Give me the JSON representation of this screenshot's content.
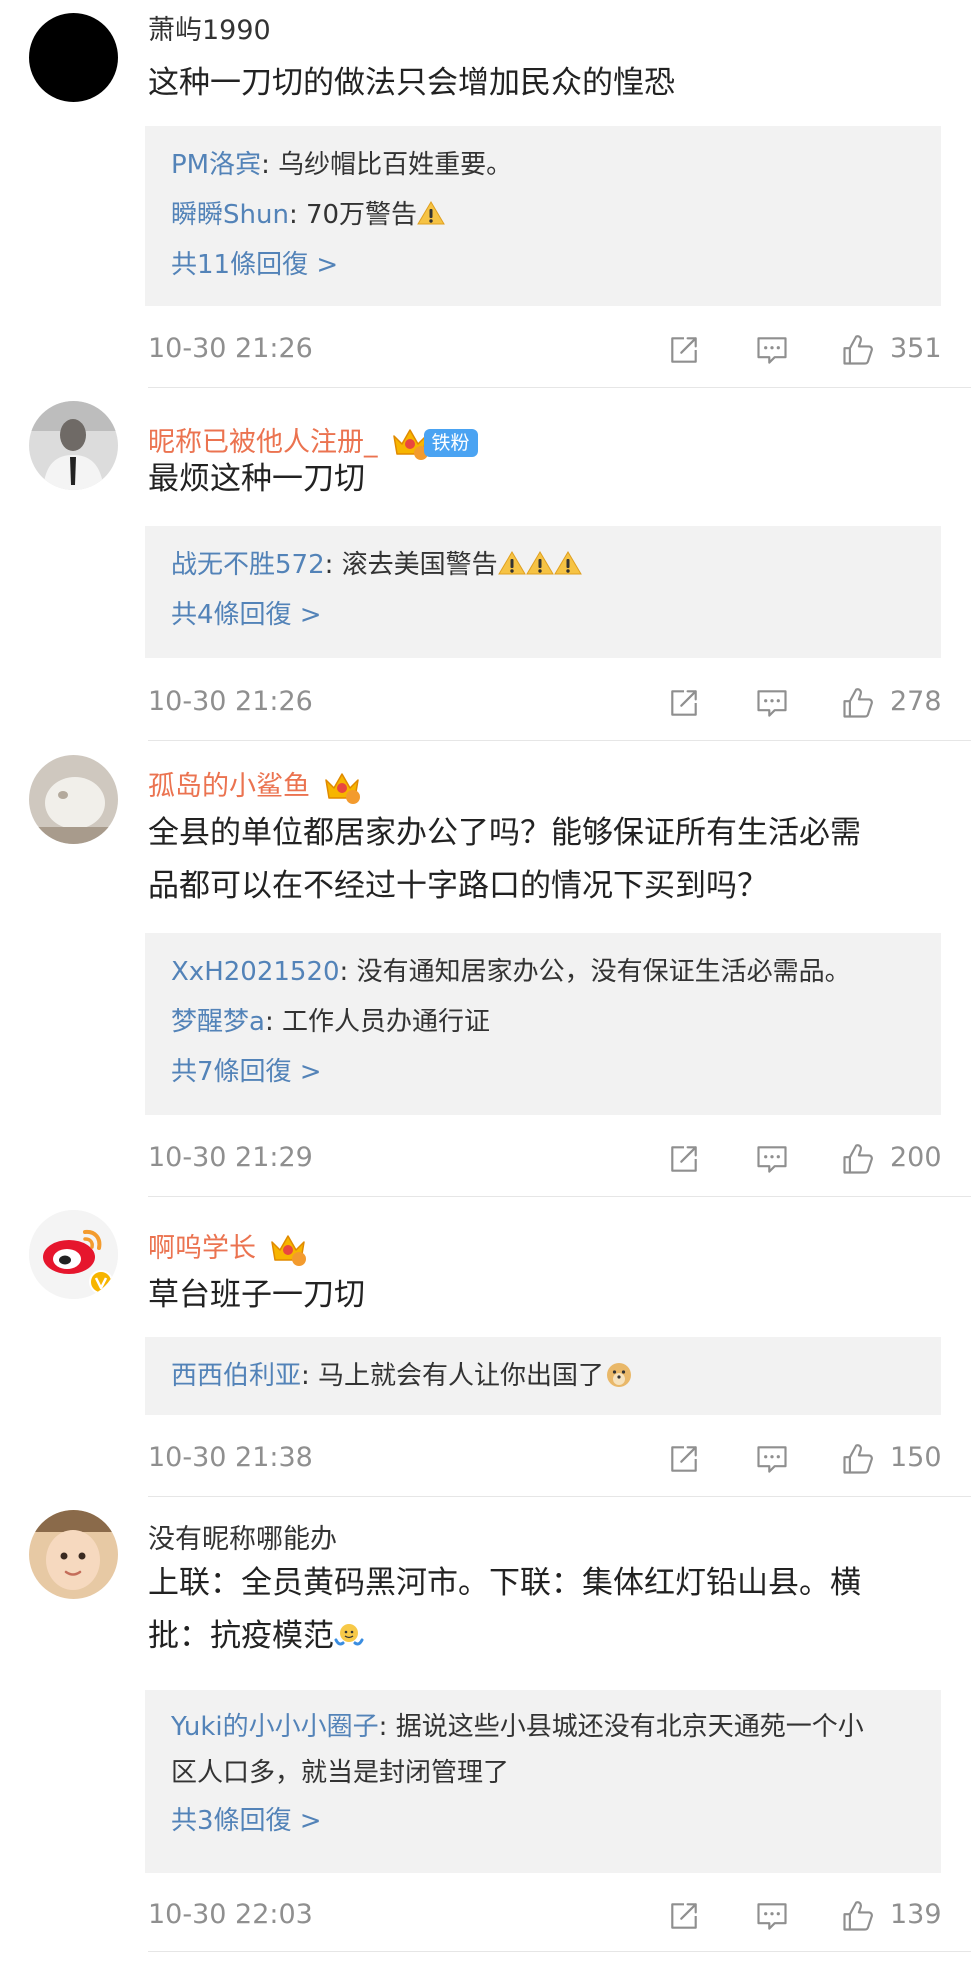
{
  "comments": [
    {
      "username": "萧屿1990",
      "text": "这种一刀切的做法只会增加民众的惶恐",
      "replies": [
        {
          "user": "PM洛宾",
          "text": ": 乌纱帽比百姓重要。"
        },
        {
          "user": "瞬瞬Shun",
          "text": ": 70万警告"
        }
      ],
      "more": "共11條回復 >",
      "time": "10-30 21:26",
      "likes": "351"
    },
    {
      "username": "昵称已被他人注册_",
      "badge": "铁粉",
      "text": "最烦这种一刀切",
      "replies": [
        {
          "user": "战无不胜572",
          "text": ": 滚去美国警告"
        }
      ],
      "more": "共4條回復 >",
      "time": "10-30 21:26",
      "likes": "278"
    },
    {
      "username": "孤岛的小鲨鱼",
      "crown_level": "5",
      "text_line1": "全县的单位都居家办公了吗？能够保证所有生活必需",
      "text_line2": "品都可以在不经过十字路口的情况下买到吗？",
      "replies": [
        {
          "user": "XxH2021520",
          "text": ": 没有通知居家办公，没有保证生活必需品。"
        },
        {
          "user": "梦醒梦a",
          "text": ": 工作人员办通行证"
        }
      ],
      "more": "共7條回復 >",
      "time": "10-30 21:29",
      "likes": "200"
    },
    {
      "username": "啊呜学长",
      "crown_level": "5",
      "text": "草台班子一刀切",
      "replies": [
        {
          "user": "西西伯利亚",
          "text": ": 马上就会有人让你出国了"
        }
      ],
      "time": "10-30 21:38",
      "likes": "150"
    },
    {
      "username": "没有昵称哪能办",
      "text_line1": "上联：全员黄码黑河市。下联：集体红灯铅山县。横",
      "text_line2": "批：抗疫模范",
      "replies": [
        {
          "user": "Yuki的小小小圈子",
          "text": ": 据说这些小县城还没有北京天通苑一个小",
          "text2": "区人口多，就当是封闭管理了"
        }
      ],
      "more": "共3條回復 >",
      "time": "10-30 22:03",
      "likes": "139"
    }
  ],
  "colors": {
    "link_blue": "#5383b8",
    "orange_name": "#eb7350",
    "meta_gray": "#8f8f8f",
    "reply_bg": "#f2f2f2"
  },
  "icons": [
    "share-icon",
    "comment-icon",
    "like-icon",
    "warning-icon",
    "crown-icon",
    "doge-emoji",
    "shrug-emoji"
  ]
}
